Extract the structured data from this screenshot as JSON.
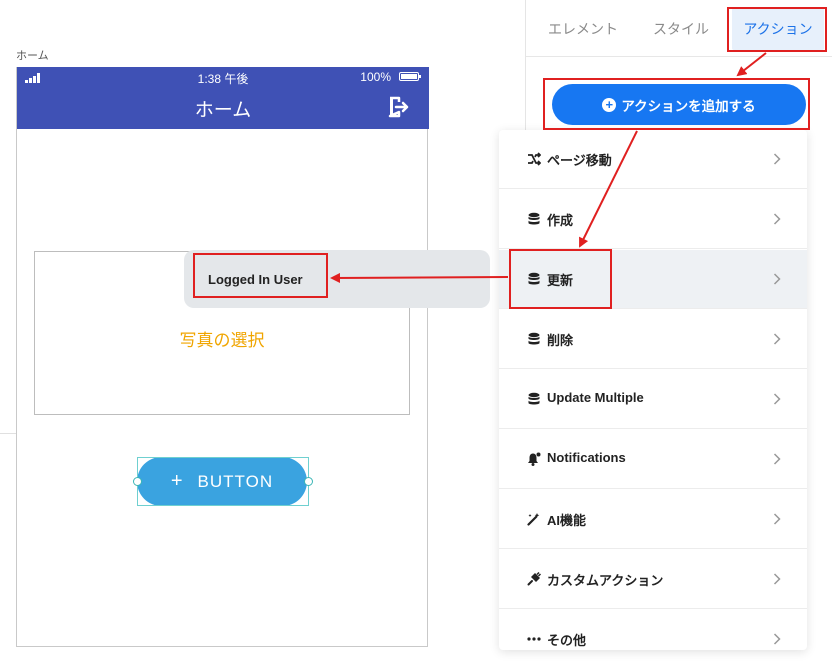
{
  "canvas": {
    "screen_label": "ホーム"
  },
  "phone": {
    "status_time": "1:38 午後",
    "battery_percent": "100%",
    "app_bar_title": "ホーム",
    "photo_label": "写真の選択",
    "button_label": "BUTTON",
    "button_plus": "+",
    "accent_color": "#3f51b5"
  },
  "panel": {
    "tabs": [
      {
        "label": "エレメント"
      },
      {
        "label": "スタイル"
      },
      {
        "label": "アクション"
      }
    ],
    "add_action_label": "アクションを追加する",
    "add_action_icon": "+",
    "action_menu": [
      {
        "label": "ページ移動",
        "icon": "shuffle-icon"
      },
      {
        "label": "作成",
        "icon": "database-icon"
      },
      {
        "label": "更新",
        "icon": "database-icon"
      },
      {
        "label": "削除",
        "icon": "database-icon"
      },
      {
        "label": "Update Multiple",
        "icon": "database-icon"
      },
      {
        "label": "Notifications",
        "icon": "bell-icon"
      },
      {
        "label": "AI機能",
        "icon": "magic-wand-icon"
      },
      {
        "label": "カスタムアクション",
        "icon": "plug-icon"
      },
      {
        "label": "その他",
        "icon": "more-icon"
      }
    ],
    "submenu": {
      "label": "Logged In User"
    }
  }
}
